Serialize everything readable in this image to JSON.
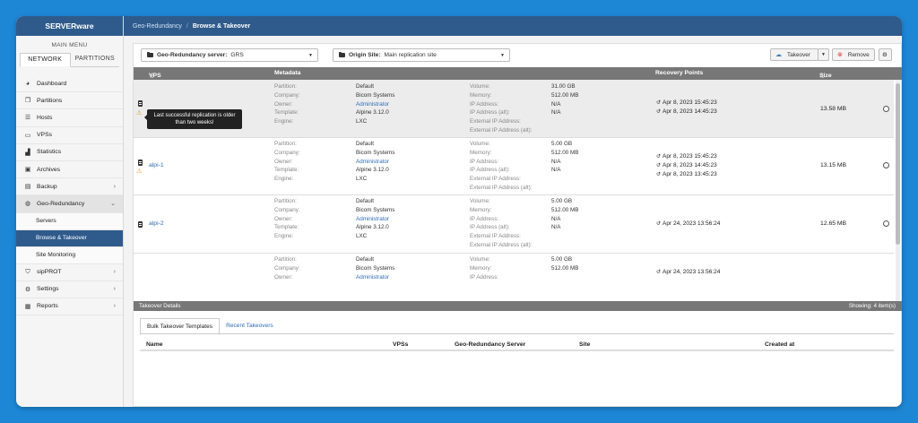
{
  "app": {
    "brand": "SERVERware"
  },
  "breadcrumb": {
    "parent": "Geo-Redundancy",
    "separator": "/",
    "current": "Browse & Takeover"
  },
  "sidebar": {
    "main_menu": "MAIN MENU",
    "tabs": [
      "NETWORK",
      "PARTITIONS"
    ],
    "items": [
      {
        "label": "Dashboard",
        "icon": "dashboard-icon"
      },
      {
        "label": "Partitions",
        "icon": "partitions-icon"
      },
      {
        "label": "Hosts",
        "icon": "hosts-icon"
      },
      {
        "label": "VPSs",
        "icon": "monitor-icon"
      },
      {
        "label": "Statistics",
        "icon": "chart-icon"
      },
      {
        "label": "Archives",
        "icon": "archive-icon"
      },
      {
        "label": "Backup",
        "icon": "backup-icon"
      },
      {
        "label": "Geo-Redundancy",
        "icon": "globe-icon"
      },
      {
        "label": "sipPROT",
        "icon": "shield-icon"
      },
      {
        "label": "Settings",
        "icon": "gears-icon"
      },
      {
        "label": "Reports",
        "icon": "reports-icon"
      }
    ],
    "sub_items": [
      "Servers",
      "Browse & Takeover",
      "Site Monitoring"
    ]
  },
  "toolbar": {
    "geo_label": "Geo-Redundancy server:",
    "geo_value": "GRS",
    "origin_label": "Origin Site:",
    "origin_value": "Main replication site",
    "takeover": "Takeover",
    "remove": "Remove"
  },
  "table": {
    "headers": {
      "vps": "VPS",
      "metadata": "Metadata",
      "recovery": "Recovery Points",
      "size": "Size"
    },
    "meta_labels": [
      "Partition:",
      "Company:",
      "Owner:",
      "Template:",
      "Engine:"
    ],
    "meta2_labels": [
      "Volume:",
      "Memory:",
      "IP Address:",
      "IP Address (alt):",
      "External IP Address:",
      "External IP Address (alt):"
    ],
    "tooltip": "Last successful replication is older than two weeks!",
    "rows": [
      {
        "name": "",
        "partition": "Default",
        "company": "Bicom Systems",
        "owner": "Administrator",
        "template": "Alpine 3.12.0",
        "engine": "LXC",
        "volume": "31.00 GB",
        "memory": "512.00 MB",
        "ip": "",
        "ip_alt": "N/A",
        "ext_ip": "",
        "ext_ip_alt": "N/A",
        "recovery": [
          "Apr 8, 2023 15:45:23",
          "Apr 8, 2023 14:45:23"
        ],
        "size": "13.58 MB"
      },
      {
        "name": "alpi-1",
        "partition": "Default",
        "company": "Bicom Systems",
        "owner": "Administrator",
        "template": "Alpine 3.12.0",
        "engine": "LXC",
        "volume": "5.00 GB",
        "memory": "512.00 MB",
        "ip": "",
        "ip_alt": "N/A",
        "ext_ip": "",
        "ext_ip_alt": "N/A",
        "recovery": [
          "Apr 8, 2023 15:45:23",
          "Apr 8, 2023 14:45:23",
          "Apr 8, 2023 13:45:23"
        ],
        "size": "13.15 MB"
      },
      {
        "name": "alpi-2",
        "partition": "Default",
        "company": "Bicom Systems",
        "owner": "Administrator",
        "template": "Alpine 3.12.0",
        "engine": "LXC",
        "volume": "5.00 GB",
        "memory": "512.00 MB",
        "ip": "",
        "ip_alt": "N/A",
        "ext_ip": "",
        "ext_ip_alt": "N/A",
        "recovery": [
          "Apr 24, 2023 13:56:24"
        ],
        "size": "12.65 MB"
      },
      {
        "name": "",
        "partition": "Default",
        "company": "Bicom Systems",
        "owner": "Administrator",
        "template": "",
        "engine": "",
        "volume": "5.00 GB",
        "memory": "512.00 MB",
        "ip": "",
        "ip_alt": "",
        "ext_ip": "",
        "ext_ip_alt": "",
        "recovery": [
          "Apr 24, 2023 13:56:24"
        ],
        "size": ""
      }
    ]
  },
  "details": {
    "title": "Takeover Details",
    "showing": "Showing: 4 item(s)",
    "tabs": [
      "Bulk Takeover Templates",
      "Recent Takeovers"
    ],
    "columns": [
      "Name",
      "VPSs",
      "Geo-Redundancy Server",
      "Site",
      "Created at"
    ]
  }
}
